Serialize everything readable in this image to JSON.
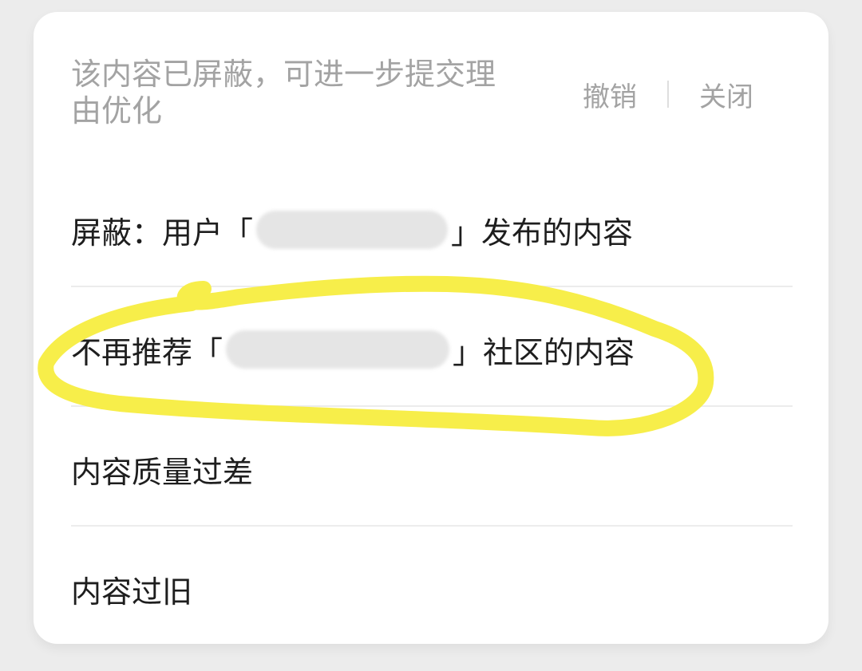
{
  "notice": {
    "line1": "该内容已屏蔽，可进一步提交理",
    "line2": "由优化"
  },
  "actions": {
    "undo": "撤销",
    "close": "关闭"
  },
  "options": [
    {
      "prefix": "屏蔽：用户「",
      "suffix": "」发布的内容"
    },
    {
      "prefix": "不再推荐「",
      "suffix": "」社区的内容"
    },
    {
      "label": "内容质量过差"
    },
    {
      "label": "内容过旧"
    }
  ],
  "colors": {
    "highlight": "#f7ee4a",
    "muted_text": "#a3a3a3",
    "text": "#1e1e1e"
  }
}
